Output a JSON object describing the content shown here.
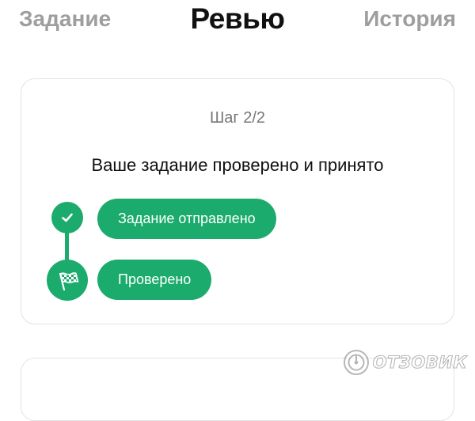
{
  "tabs": {
    "left": "Задание",
    "active": "Ревью",
    "right": "История"
  },
  "review": {
    "step": "Шаг 2/2",
    "title": "Ваше задание проверено и принято",
    "stages": [
      {
        "label": "Задание отправлено",
        "icon": "check-icon"
      },
      {
        "label": "Проверено",
        "icon": "finish-flag-icon"
      }
    ]
  },
  "watermark": {
    "text": "ОТЗОВИК"
  },
  "colors": {
    "accent": "#1bab6c",
    "tab_inactive": "#9e9e9e",
    "text_primary": "#111111",
    "text_secondary": "#777777",
    "card_border": "#e3e3e3"
  }
}
